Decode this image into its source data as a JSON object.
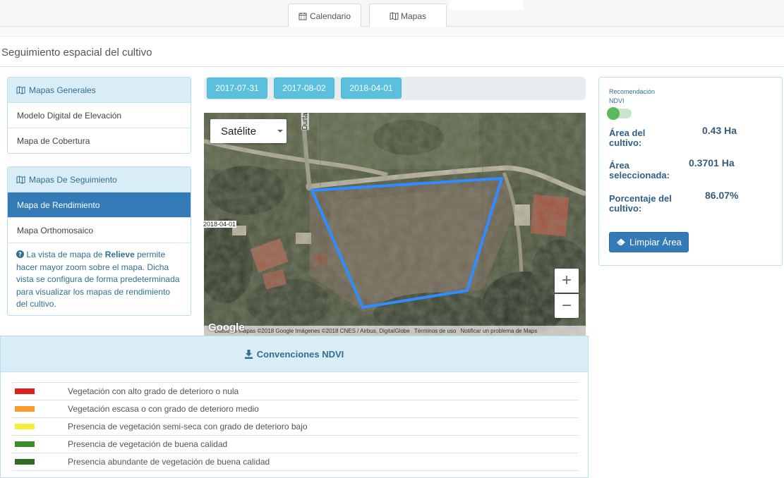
{
  "tabs": [
    {
      "label": "Calendario",
      "icon": "calendar-icon"
    },
    {
      "label": "Mapas",
      "icon": "map-icon"
    }
  ],
  "page_title": "Seguimiento espacial del cultivo",
  "general_maps": {
    "title": "Mapas Generales",
    "items": [
      "Modelo Digital de Elevación",
      "Mapa de Cobertura"
    ]
  },
  "tracking_maps": {
    "title": "Mapas De Seguimiento",
    "items": [
      "Mapa de Rendimiento",
      "Mapa Orthomosaico"
    ],
    "active_index": 0,
    "info": {
      "part1": "La vista de mapa de ",
      "bold": "Relieve",
      "part2": " permite hacer mayor zoom sobre el mapa. Dicha vista se configura de forma predeterminada para visualizar los mapas de rendimiento del cultivo."
    }
  },
  "dates": [
    "2017-07-31",
    "2017-08-02",
    "2018-04-01"
  ],
  "map": {
    "map_type": "Satélite",
    "road_label": "Durta",
    "date_tag": "2018-04-01",
    "attribution": "Datos de mapas ©2018 Google Imágenes ©2018 CNES / Airbus, DigitalGlobe",
    "terms": "Términos de uso",
    "report": "Notificar un problema de Maps",
    "logo": "Google",
    "zoom_in": "+",
    "zoom_out": "−"
  },
  "stats": {
    "recommendation_line1": "Recomendación",
    "recommendation_line2": "NDVI",
    "area_label": "Área del cultivo:",
    "area_value": "0.43 Ha",
    "selected_label": "Área seleccionada:",
    "selected_value": "0.3701 Ha",
    "percent_label": "Porcentaje del cultivo:",
    "percent_value": "86.07%",
    "clear_button": "Limpiar Área"
  },
  "ndvi": {
    "title": "Convenciones NDVI",
    "rows": [
      {
        "color": "#dd1f1f",
        "label": "Vegetación con alto grado de deterioro o nula"
      },
      {
        "color": "#fb9a2b",
        "label": "Vegetación escasa o con grado de deterioro medio"
      },
      {
        "color": "#f7ee3c",
        "label": "Presencia de vegetación semi-seca con grado de deterioro bajo"
      },
      {
        "color": "#3f8a2a",
        "label": "Presencia de vegetación de buena calidad"
      },
      {
        "color": "#2f6e1e",
        "label": "Presencia abundante de vegetación de buena calidad"
      }
    ]
  }
}
